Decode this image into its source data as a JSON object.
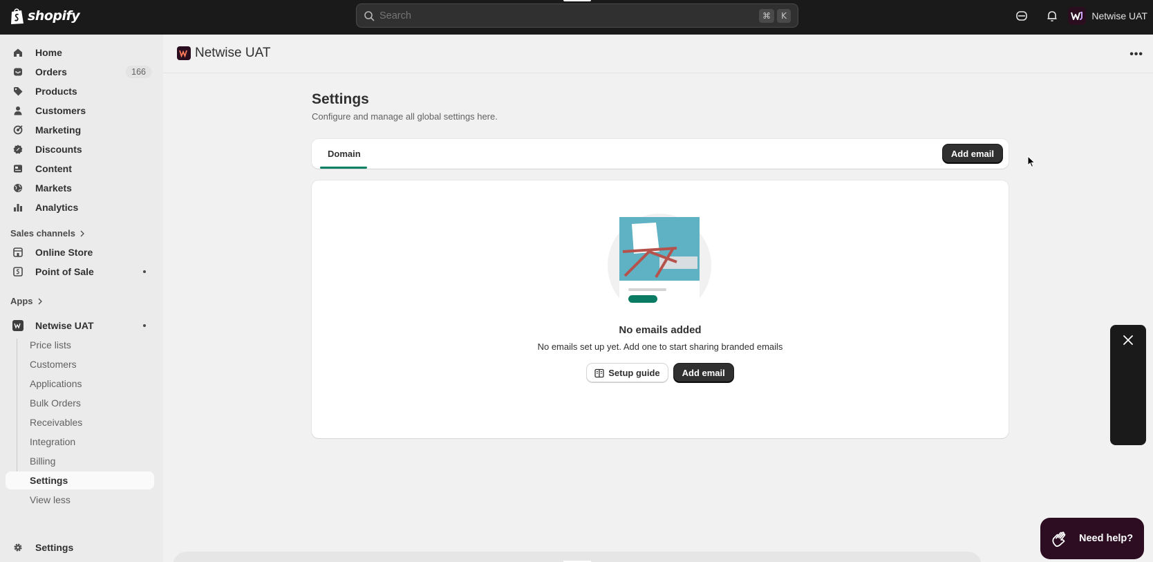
{
  "topbar": {
    "logo_text": "shopify",
    "search_placeholder": "Search",
    "shortcut_keys": [
      "⌘",
      "K"
    ],
    "store_name": "Netwise UAT"
  },
  "sidebar": {
    "main_items": [
      {
        "label": "Home",
        "icon": "home-icon"
      },
      {
        "label": "Orders",
        "icon": "inbox-icon",
        "badge": "166"
      },
      {
        "label": "Products",
        "icon": "tag-icon"
      },
      {
        "label": "Customers",
        "icon": "person-icon"
      },
      {
        "label": "Marketing",
        "icon": "target-icon"
      },
      {
        "label": "Discounts",
        "icon": "discount-icon"
      },
      {
        "label": "Content",
        "icon": "content-icon"
      },
      {
        "label": "Markets",
        "icon": "globe-icon"
      },
      {
        "label": "Analytics",
        "icon": "bar-chart-icon"
      }
    ],
    "sales_channels_label": "Sales channels",
    "sales_channels": [
      {
        "label": "Online Store",
        "icon": "store-icon"
      },
      {
        "label": "Point of Sale",
        "icon": "pos-icon"
      }
    ],
    "apps_label": "Apps",
    "app": {
      "label": "Netwise UAT",
      "icon": "netwise-app-icon"
    },
    "app_sub_items": [
      "Price lists",
      "Customers",
      "Applications",
      "Bulk Orders",
      "Receivables",
      "Integration",
      "Billing",
      "Settings",
      "View less"
    ],
    "settings_label": "Settings"
  },
  "app_header": {
    "title": "Netwise UAT"
  },
  "page": {
    "title": "Settings",
    "subtitle": "Configure and manage all global settings here.",
    "tab_label": "Domain",
    "add_email_label": "Add email",
    "empty_title": "No emails added",
    "empty_desc": "No emails set up yet. Add one to start sharing branded emails",
    "setup_guide_label": "Setup guide",
    "empty_add_email_label": "Add email"
  },
  "help": {
    "label": "Need help?"
  },
  "colors": {
    "topbar": "#1a1a1a",
    "accent": "#008060",
    "help_button": "#2c0d22"
  }
}
